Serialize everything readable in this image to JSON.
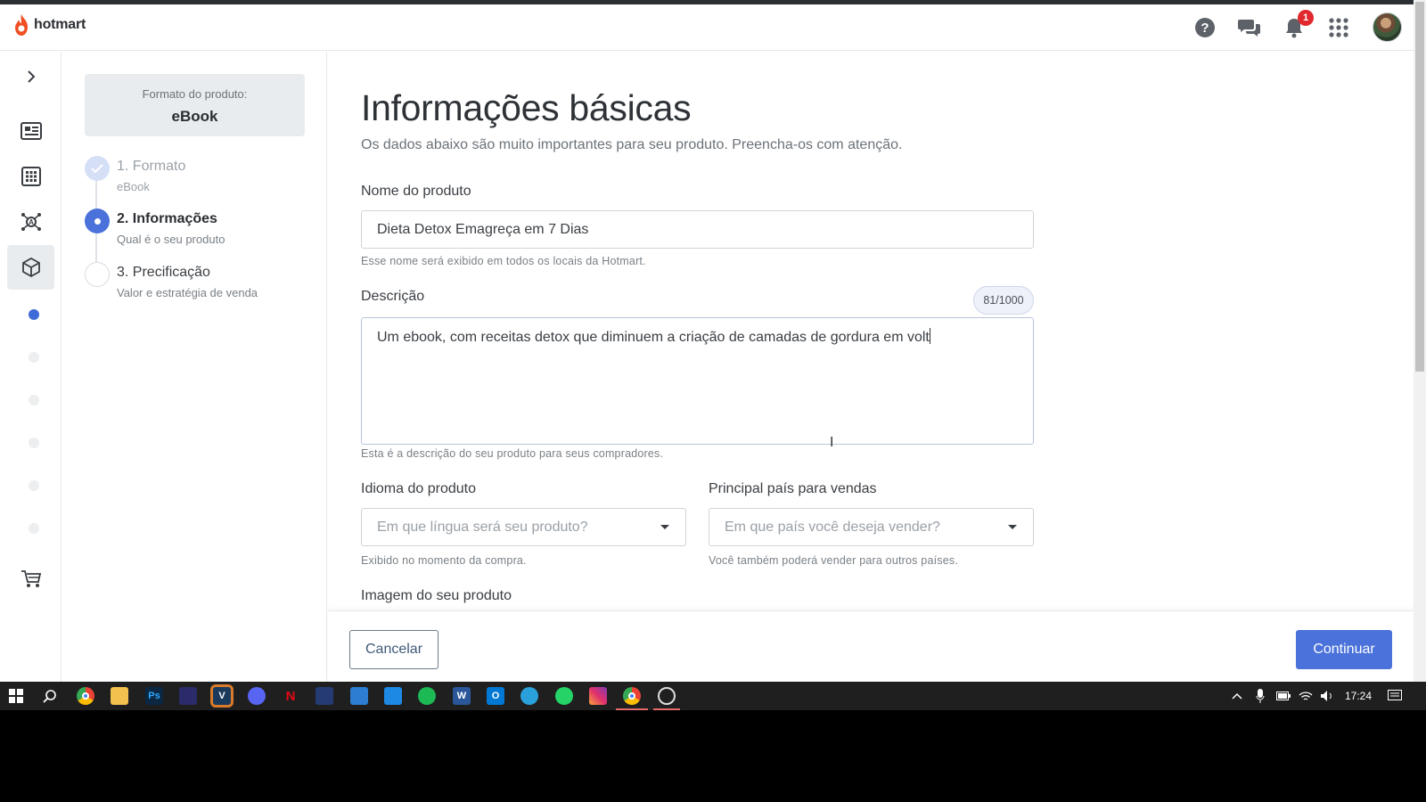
{
  "brand": {
    "name": "hotmart",
    "color": "#f04e23"
  },
  "header": {
    "icons": [
      "help-icon",
      "chat-icon",
      "bell-icon",
      "apps-grid-icon"
    ],
    "notification_count": "1"
  },
  "rail": {
    "icons": [
      "chevron-right-icon",
      "dashboard-icon",
      "grid-icon",
      "network-icon",
      "box-icon",
      "cart-icon"
    ],
    "active": "box-icon",
    "accent": "#3f6bd8"
  },
  "stepper": {
    "format_label": "Formato do produto:",
    "format_value": "eBook",
    "steps": [
      {
        "title": "1. Formato",
        "subtitle": "eBook",
        "state": "done"
      },
      {
        "title": "2. Informações",
        "subtitle": "Qual é o seu produto",
        "state": "current"
      },
      {
        "title": "3. Precificação",
        "subtitle": "Valor e estratégia de venda",
        "state": "todo"
      }
    ]
  },
  "main": {
    "title": "Informações básicas",
    "subtitle": "Os dados abaixo são muito importantes para seu produto. Preencha-os com atenção.",
    "name_label": "Nome do produto",
    "name_value": "Dieta Detox Emagreça em 7 Dias",
    "name_hint": "Esse nome será exibido em todos os locais da Hotmart.",
    "description_label": "Descrição",
    "description_counter": "81/1000",
    "description_value": "Um ebook, com receitas detox que diminuem a criação de camadas de gordura em volt",
    "description_hint": "Esta é a descrição do seu produto para seus compradores.",
    "language_label": "Idioma do produto",
    "language_placeholder": "Em que língua será seu produto?",
    "language_hint": "Exibido no momento da compra.",
    "country_label": "Principal país para vendas",
    "country_placeholder": "Em que país você deseja vender?",
    "country_hint": "Você também poderá vender para outros países.",
    "image_label": "Imagem do seu produto"
  },
  "actions": {
    "cancel_label": "Cancelar",
    "continue_label": "Continuar",
    "primary_color": "#4a72da"
  },
  "taskbar": {
    "apps": [
      "windows-start-icon",
      "search-icon",
      "chrome-icon",
      "file-explorer-icon",
      "photoshop-icon",
      "app-icon",
      "vegas-icon",
      "discord-icon",
      "netflix-icon",
      "app-icon",
      "app-icon",
      "mail-icon",
      "spotify-icon",
      "word-icon",
      "outlook-icon",
      "telegram-icon",
      "whatsapp-icon",
      "instagram-icon",
      "chrome-icon",
      "obs-icon"
    ],
    "clock": "17:24"
  }
}
